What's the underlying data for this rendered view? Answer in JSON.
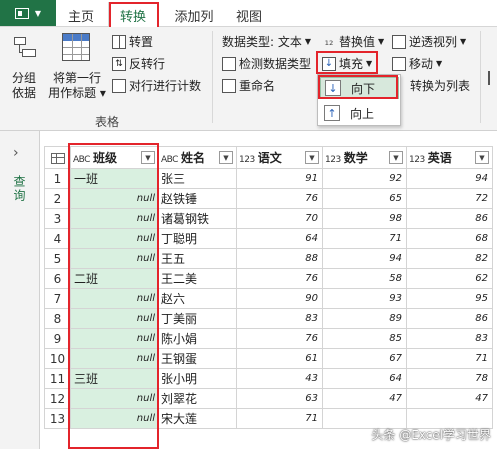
{
  "tabs": [
    "主页",
    "转换",
    "添加列",
    "视图"
  ],
  "ribbon": {
    "group_by": [
      "分组",
      "依据"
    ],
    "first_row_header": [
      "将第一行",
      "用作标题"
    ],
    "transpose": "转置",
    "reverse_rows": "反转行",
    "count_rows": "对行进行计数",
    "table_group_label": "表格",
    "data_type": "数据类型: 文本",
    "detect_type": "检测数据类型",
    "rename": "重命名",
    "replace_values": "替换值",
    "fill": "填充",
    "unpivot": "逆透视列",
    "move": "移动",
    "to_list": "转换为列表"
  },
  "fill_menu": {
    "down": "向下",
    "up": "向上"
  },
  "query_pane": {
    "label": "查询"
  },
  "table": {
    "columns": [
      {
        "type": "ABC",
        "name": "班级"
      },
      {
        "type": "ABC",
        "name": "姓名"
      },
      {
        "type": "123",
        "name": "语文"
      },
      {
        "type": "123",
        "name": "数学"
      },
      {
        "type": "123",
        "name": "英语"
      }
    ],
    "rows": [
      {
        "n": "1",
        "cls": "一班",
        "name": "张三",
        "a": "91",
        "b": "92",
        "c": "94"
      },
      {
        "n": "2",
        "cls": "null",
        "name": "赵铁锤",
        "a": "76",
        "b": "65",
        "c": "72"
      },
      {
        "n": "3",
        "cls": "null",
        "name": "诸葛钢铁",
        "a": "70",
        "b": "98",
        "c": "86"
      },
      {
        "n": "4",
        "cls": "null",
        "name": "丁聪明",
        "a": "64",
        "b": "71",
        "c": "68"
      },
      {
        "n": "5",
        "cls": "null",
        "name": "王五",
        "a": "88",
        "b": "94",
        "c": "82"
      },
      {
        "n": "6",
        "cls": "二班",
        "name": "王二美",
        "a": "76",
        "b": "58",
        "c": "62"
      },
      {
        "n": "7",
        "cls": "null",
        "name": "赵六",
        "a": "90",
        "b": "93",
        "c": "95"
      },
      {
        "n": "8",
        "cls": "null",
        "name": "丁美丽",
        "a": "83",
        "b": "89",
        "c": "86"
      },
      {
        "n": "9",
        "cls": "null",
        "name": "陈小娟",
        "a": "76",
        "b": "85",
        "c": "83"
      },
      {
        "n": "10",
        "cls": "null",
        "name": "王钢蛋",
        "a": "61",
        "b": "67",
        "c": "71"
      },
      {
        "n": "11",
        "cls": "三班",
        "name": "张小明",
        "a": "43",
        "b": "64",
        "c": "78"
      },
      {
        "n": "12",
        "cls": "null",
        "name": "刘翠花",
        "a": "63",
        "b": "47",
        "c": "47"
      },
      {
        "n": "13",
        "cls": "null",
        "name": "宋大莲",
        "a": "71",
        "b": "",
        "c": ""
      }
    ]
  },
  "watermark": "头条 @Excel学习世界",
  "colors": {
    "accent": "#217346",
    "highlight": "#e3242b",
    "null_fill": "#d9f0e0"
  }
}
